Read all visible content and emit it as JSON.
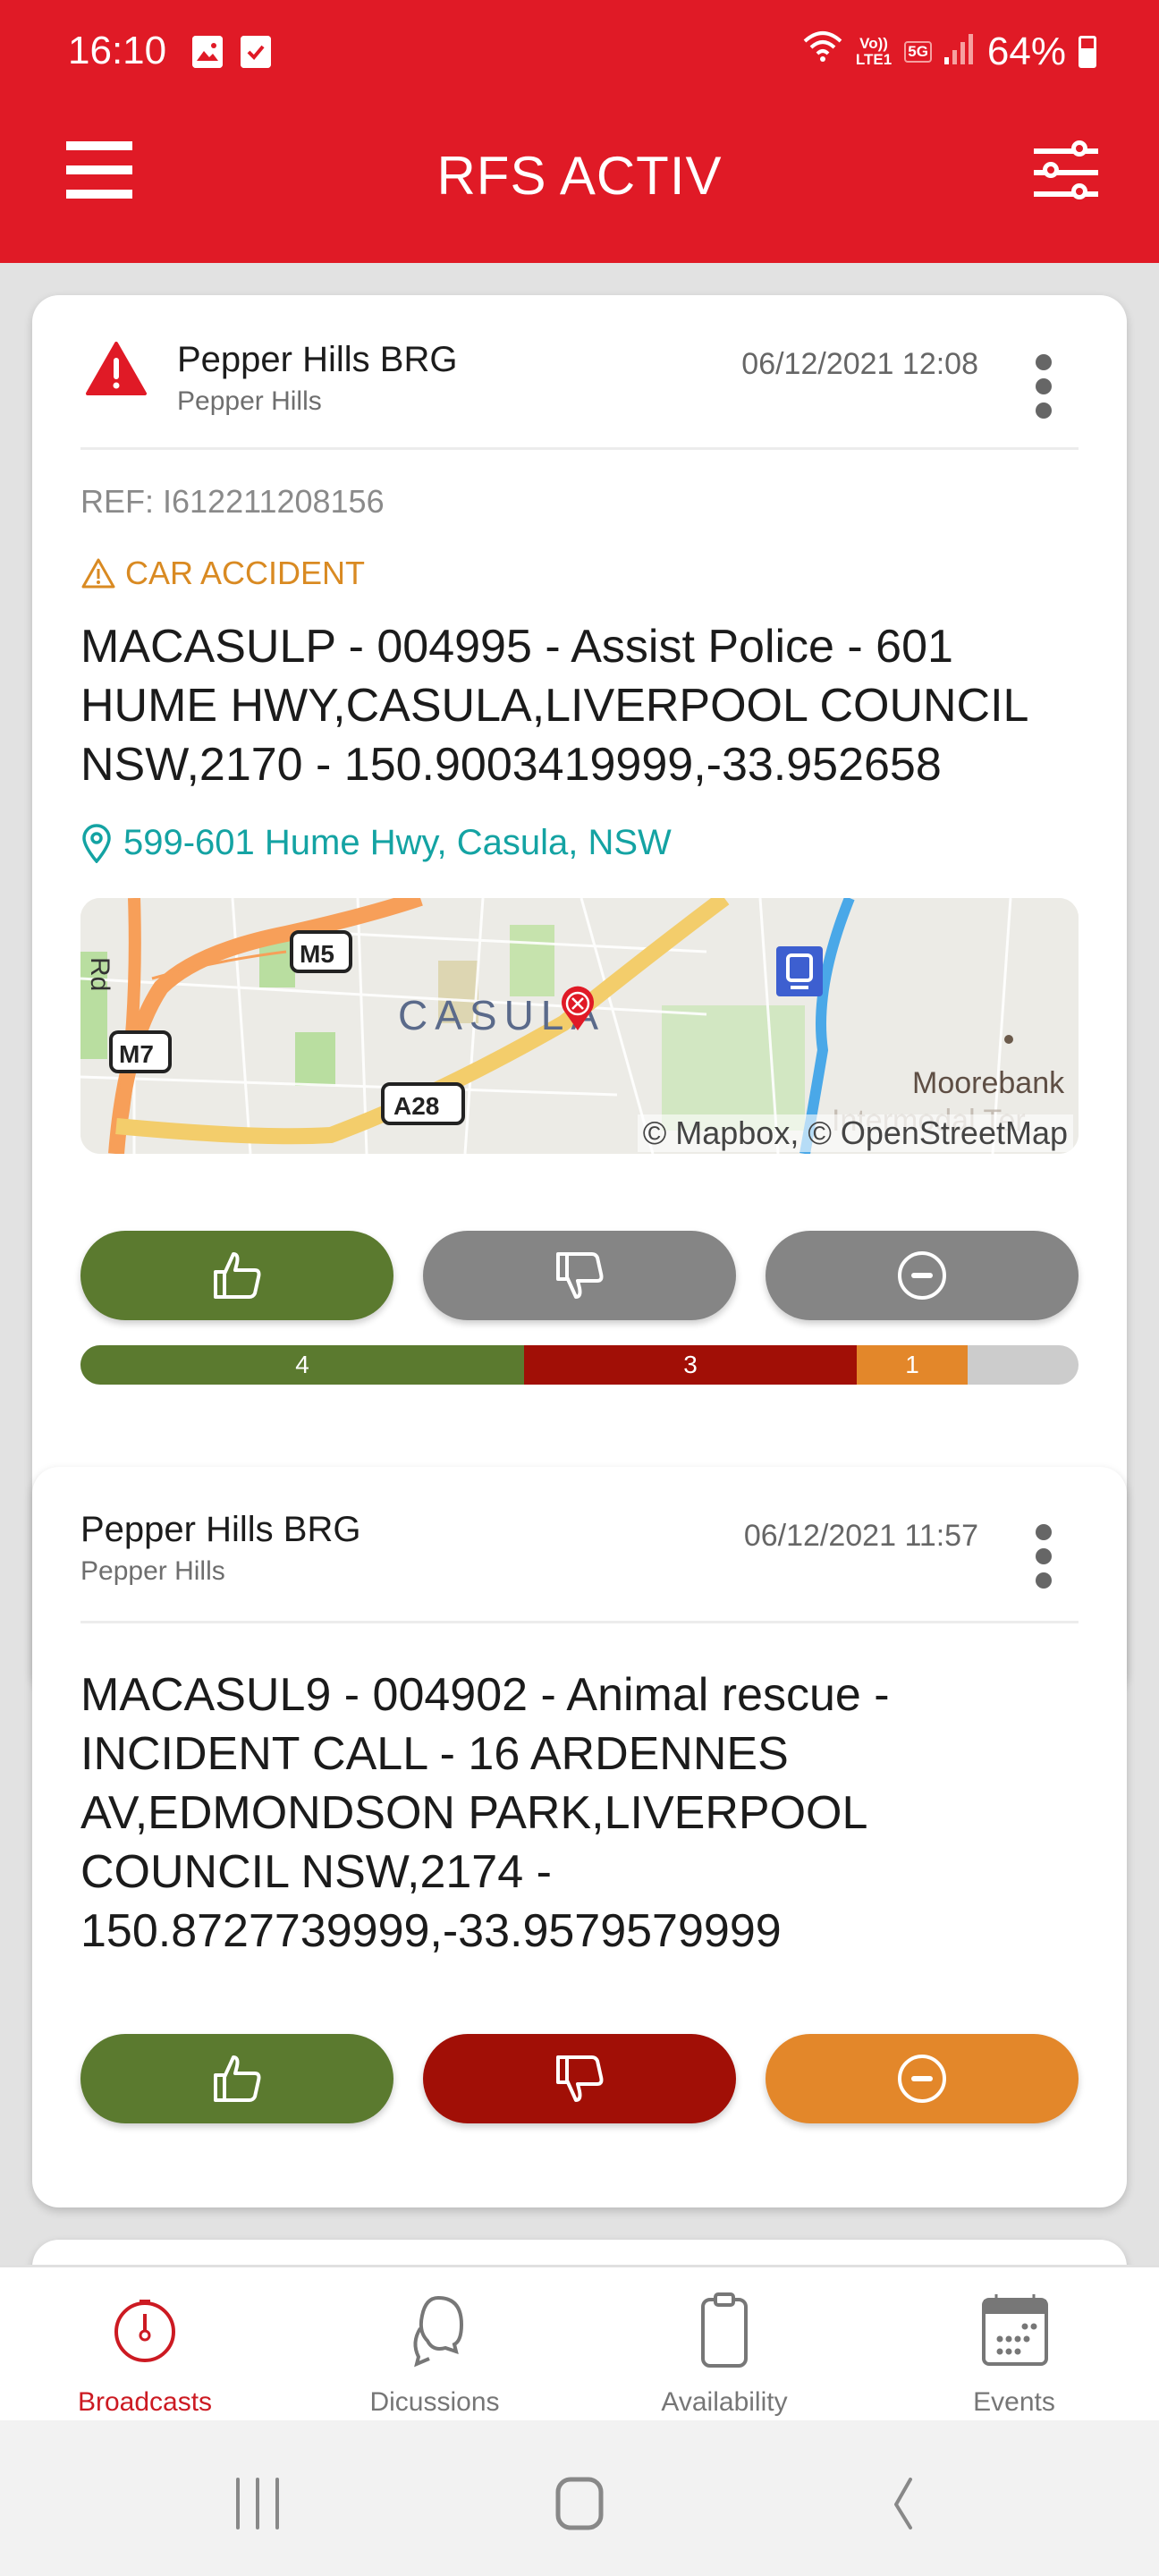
{
  "status_bar": {
    "time": "16:10",
    "left_icons": [
      "gallery-icon",
      "checkbox-icon"
    ],
    "volte_top": "Vo))",
    "volte_bottom": "LTE1",
    "network": "5G",
    "battery": "64%",
    "battery_level": 0.64
  },
  "app_bar": {
    "title": "RFS ACTIV",
    "left_icon": "hamburger-menu-icon",
    "right_icon": "filter-sliders-icon"
  },
  "broadcasts": [
    {
      "sender": "Pepper Hills BRG",
      "sender_sub": "Pepper Hills",
      "timestamp": "06/12/2021 12:08",
      "has_alert_icon": true,
      "ref": "REF: I612211208156",
      "category": "CAR ACCIDENT",
      "message": "MACASULP - 004995 - Assist Police - 601 HUME HWY,CASULA,LIVERPOOL COUNCIL NSW,2170 - 150.9003419999,-33.952658",
      "address": "599-601 Hume Hwy, Casula, NSW",
      "map": {
        "place_label": "CASULA",
        "road_labels": [
          "M5",
          "M7",
          "A28"
        ],
        "area_label": "Moorebank",
        "area_label_faded": "Intermodal Ter",
        "side_label": "Rd",
        "attribution": "© Mapbox, © OpenStreetMap"
      },
      "buttons": {
        "accept": {
          "icon": "thumbs-up-icon",
          "color": "#5b7a2f",
          "selected": true
        },
        "decline": {
          "icon": "thumbs-down-icon",
          "color": "#858585",
          "selected": false
        },
        "neutral": {
          "icon": "minus-circle-icon",
          "color": "#858585",
          "selected": false
        }
      },
      "responses": {
        "accept": 4,
        "decline": 3,
        "neutral": 1,
        "total": 9,
        "colors": {
          "accept": "#5b7a2f",
          "decline": "#a10f06",
          "neutral": "#e3872a",
          "none": "#cccccc"
        }
      }
    },
    {
      "sender": "Pepper Hills BRG",
      "sender_sub": "Pepper Hills",
      "timestamp": "06/12/2021 11:57",
      "has_alert_icon": false,
      "message": "MACASUL9 - 004902 - Animal rescue - INCIDENT CALL - 16 ARDENNES AV,EDMONDSON PARK,LIVERPOOL COUNCIL NSW,2174 - 150.8727739999,-33.9579579999",
      "buttons": {
        "accept": {
          "icon": "thumbs-up-icon",
          "color": "#5b7a2f"
        },
        "decline": {
          "icon": "thumbs-down-icon",
          "color": "#a10f06"
        },
        "neutral": {
          "icon": "minus-circle-icon",
          "color": "#e3872a"
        }
      }
    }
  ],
  "bottom_nav": [
    {
      "label": "Broadcasts",
      "icon": "broadcast-timer-icon",
      "active": true
    },
    {
      "label": "Dicussions",
      "icon": "chat-bubbles-icon",
      "active": false
    },
    {
      "label": "Availability",
      "icon": "clipboard-icon",
      "active": false
    },
    {
      "label": "Events",
      "icon": "calendar-icon",
      "active": false
    }
  ],
  "system_nav": [
    "recent-apps-icon",
    "home-icon",
    "back-icon"
  ],
  "colors": {
    "brand_red": "#e01a26",
    "address_teal": "#14a3a3",
    "category_orange": "#d98a22",
    "active_nav": "#cc1a22"
  }
}
